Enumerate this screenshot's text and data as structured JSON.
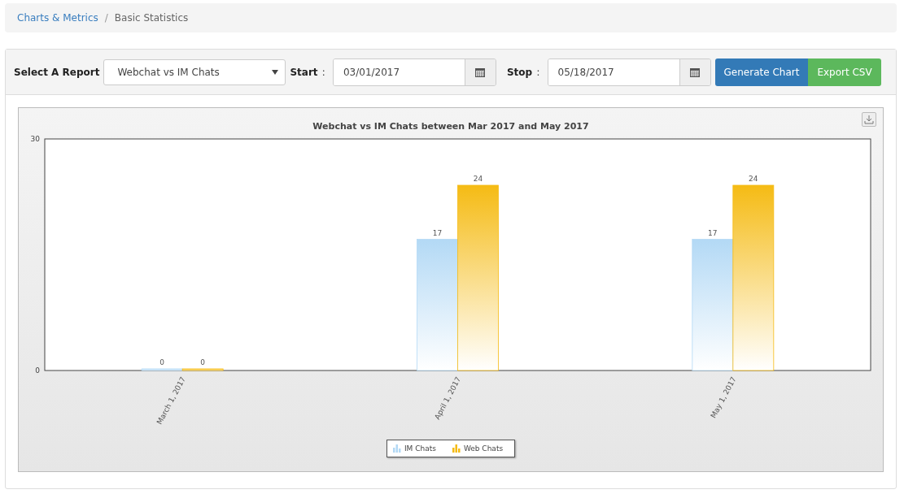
{
  "breadcrumb": [
    {
      "label": "Charts & Metrics",
      "kind": "link"
    },
    {
      "label": "/",
      "kind": "separator"
    },
    {
      "label": "Basic Statistics",
      "kind": "current"
    }
  ],
  "toolbar": {
    "report_label": "Select A Report",
    "report_value": "Webchat vs IM Chats",
    "start_label": "Start",
    "start_value": "03/01/2017",
    "stop_label": "Stop",
    "stop_value": "05/18/2017",
    "separator": ":",
    "buttons": [
      {
        "label": "Generate Chart",
        "kind": "primary"
      },
      {
        "label": "Export CSV",
        "kind": "success"
      }
    ]
  },
  "chart": {
    "chart_data": {
      "type": "bar",
      "title": "Webchat vs IM Chats between Mar 2017 and May 2017",
      "categories": [
        "March 1, 2017",
        "April 1, 2017",
        "May 1, 2017"
      ],
      "series": [
        {
          "name": "IM Chats",
          "color": "#b3d9f5",
          "values": [
            0,
            17,
            17
          ]
        },
        {
          "name": "Web Chats",
          "color": "#f5bb14",
          "values": [
            0,
            24,
            24
          ]
        }
      ],
      "ylim": [
        0,
        30
      ],
      "yticks": [
        0,
        30
      ],
      "data_labels": true
    }
  }
}
